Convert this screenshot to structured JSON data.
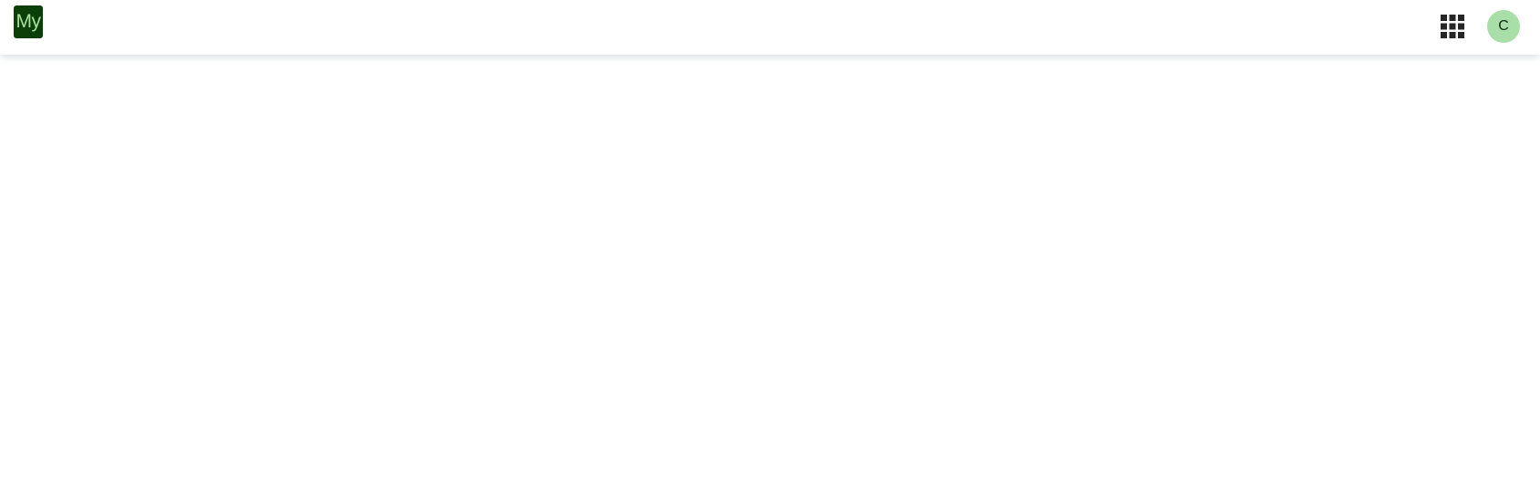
{
  "header": {
    "logo": {
      "text": "My",
      "background_color": "#0b3f08",
      "text_color": "#a9dfa0"
    },
    "apps_button": {
      "icon": "grid-icon",
      "color": "#262626"
    },
    "avatar": {
      "initial": "C",
      "background_color": "#a8dea7",
      "text_color": "#132a12"
    }
  },
  "main": {}
}
